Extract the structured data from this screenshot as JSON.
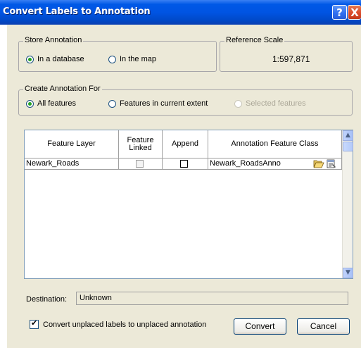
{
  "window": {
    "title": "Convert Labels to Annotation",
    "help_glyph": "?",
    "close_glyph": "X"
  },
  "store_annotation": {
    "legend": "Store Annotation",
    "options": [
      {
        "label": "In a database",
        "checked": true
      },
      {
        "label": "In the map",
        "checked": false
      }
    ]
  },
  "reference_scale": {
    "legend": "Reference Scale",
    "value": "1:597,871"
  },
  "create_annotation_for": {
    "legend": "Create Annotation For",
    "options": [
      {
        "label": "All features",
        "checked": true,
        "enabled": true
      },
      {
        "label": "Features in current extent",
        "checked": false,
        "enabled": true
      },
      {
        "label": "Selected features",
        "checked": false,
        "enabled": false
      }
    ]
  },
  "grid": {
    "columns": [
      "Feature Layer",
      "Feature Linked",
      "Append",
      "Annotation Feature Class"
    ],
    "rows": [
      {
        "feature_layer": "Newark_Roads",
        "feature_linked": false,
        "append": false,
        "annotation_feature_class": "Newark_RoadsAnno"
      }
    ]
  },
  "destination": {
    "label": "Destination:",
    "value": "Unknown"
  },
  "unplaced": {
    "label": "Convert unplaced labels to unplaced annotation",
    "checked": true
  },
  "buttons": {
    "convert": "Convert",
    "cancel": "Cancel"
  },
  "icons": {
    "open_folder": "folder-open-icon",
    "properties": "properties-icon",
    "scroll_up": "scroll-up-arrow-icon",
    "scroll_down": "scroll-down-arrow-icon"
  }
}
